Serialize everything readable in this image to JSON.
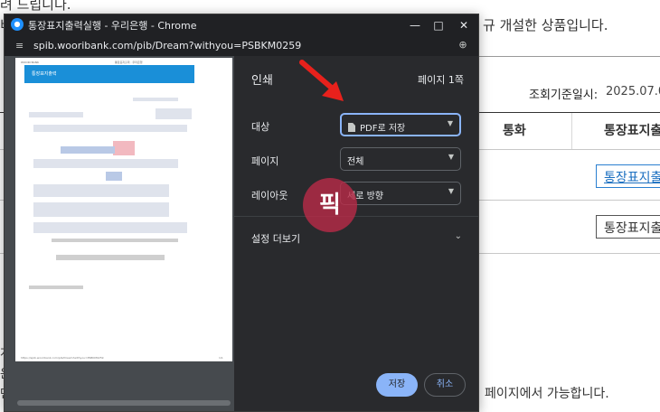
{
  "background_page": {
    "top_text": "려 드립니다.",
    "notice_fragment": "규 개설한 상품입니다.",
    "left_clip_1": "비",
    "query_date_label": "조회기준일시:",
    "query_date_value": "2025.07.02",
    "table_header_currency": "통화",
    "table_header_bankbook": "통장표지출",
    "row1_button": "통장표지출",
    "row2_button": "통장표지출",
    "footer_text": "페이지에서 가능합니다.",
    "left_clip_2": "운",
    "left_clip_3": "면",
    "left_clip_4": "개"
  },
  "window": {
    "title": "통장표지출력실행 - 우리은행 - Chrome",
    "url": "spib.wooribank.com/pib/Dream?withyou=PSBKM0259",
    "icons": {
      "favicon": "woori-bank-favicon",
      "minimize": "minimize-icon",
      "maximize": "maximize-icon",
      "close": "close-icon",
      "site_info": "tune-icon",
      "zoom": "zoom-icon"
    }
  },
  "preview": {
    "header_left": "WOORI BANK",
    "header_right": "통장표지출력 · 우리은행",
    "banner_title": "통장표지출력",
    "footer_url": "https://spib.wooribank.com/pib/Dream?withyou=PSBKM0259",
    "footer_page": "1/1"
  },
  "print_dialog": {
    "title": "인쇄",
    "page_count": "페이지 1쪽",
    "destination_label": "대상",
    "destination_value": "PDF로 저장",
    "pages_label": "페이지",
    "pages_value": "전체",
    "layout_label": "레이아웃",
    "layout_value": "세로 방향",
    "more_settings": "설정 더보기",
    "save_button": "저장",
    "cancel_button": "취소"
  },
  "overlay": {
    "stamp_text": "픽"
  },
  "colors": {
    "dialog_bg": "#292a2d",
    "preview_bg": "#464a4e",
    "accent": "#8ab4f8",
    "banner": "#1a8fd8",
    "arrow": "#e8211c",
    "stamp": "#bc2a48"
  }
}
